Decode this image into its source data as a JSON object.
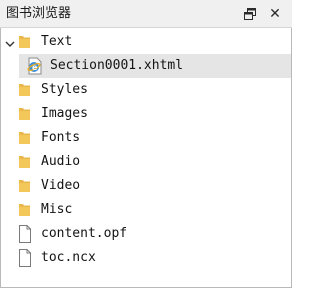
{
  "panel": {
    "title": "图书浏览器",
    "float_icon": "float-window-icon",
    "close_glyph": "✕"
  },
  "tree": {
    "text_folder": {
      "label": "Text",
      "expanded": true,
      "icon": "folder-icon"
    },
    "text_children": [
      {
        "label": "Section0001.xhtml",
        "icon": "xhtml-file-icon",
        "selected": true
      }
    ],
    "folders": [
      {
        "label": "Styles",
        "icon": "folder-icon"
      },
      {
        "label": "Images",
        "icon": "folder-icon"
      },
      {
        "label": "Fonts",
        "icon": "folder-icon"
      },
      {
        "label": "Audio",
        "icon": "folder-icon"
      },
      {
        "label": "Video",
        "icon": "folder-icon"
      },
      {
        "label": "Misc",
        "icon": "folder-icon"
      }
    ],
    "files": [
      {
        "label": "content.opf",
        "icon": "file-icon"
      },
      {
        "label": "toc.ncx",
        "icon": "file-icon"
      }
    ]
  },
  "colors": {
    "folder": "#e8b84a",
    "selection": "#e5e5e5",
    "titlebar": "#f0f0f0"
  }
}
